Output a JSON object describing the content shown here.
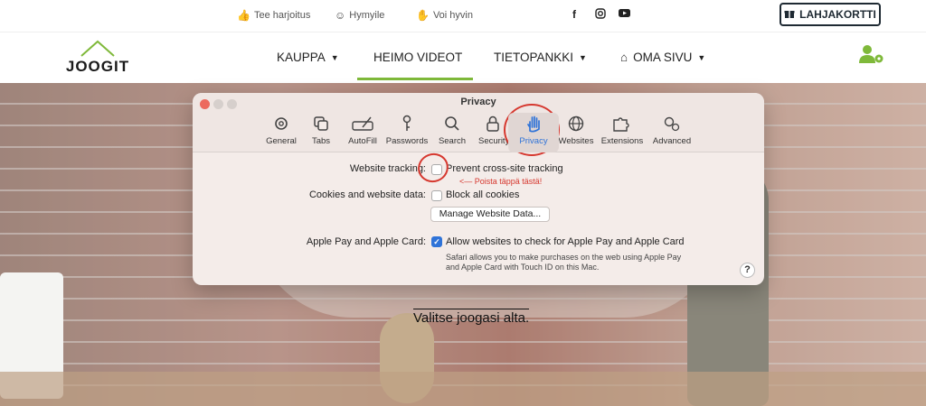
{
  "topbar": {
    "links": [
      {
        "icon": "thumbs-up-icon",
        "label": "Tee harjoitus"
      },
      {
        "icon": "smile-icon",
        "label": "Hymyile"
      },
      {
        "icon": "hand-icon",
        "label": "Voi hyvin"
      }
    ],
    "social": [
      "facebook-icon",
      "instagram-icon",
      "youtube-icon"
    ],
    "gift_button": "LAHJAKORTTI"
  },
  "nav": {
    "logo": "JOOGIT",
    "items": [
      "KAUPPA",
      "HEIMO VIDEOT",
      "TIETOPANKKI",
      "OMA SIVU"
    ],
    "active": "HEIMO VIDEOT"
  },
  "hero": {
    "subtitle": "Valitse joogasi alta."
  },
  "privacy_window": {
    "title": "Privacy",
    "toolbar": [
      "General",
      "Tabs",
      "AutoFill",
      "Passwords",
      "Search",
      "Security",
      "Privacy",
      "Websites",
      "Extensions",
      "Advanced"
    ],
    "active_tab": "Privacy",
    "website_tracking_label": "Website tracking:",
    "website_tracking_option": "Prevent cross-site tracking",
    "annotation": "<— Poista täppä tästä!",
    "cookies_label": "Cookies and website data:",
    "cookies_option": "Block all cookies",
    "manage_button": "Manage Website Data...",
    "applepay_label": "Apple Pay and Apple Card:",
    "applepay_option": "Allow websites to check for Apple Pay and Apple Card",
    "applepay_note_line1": "Safari allows you to make purchases on the web using Apple Pay",
    "applepay_note_line2": "and Apple Card with Touch ID on this Mac.",
    "help": "?"
  },
  "colors": {
    "accent_green": "#7fb93a",
    "safari_blue": "#2f73d8",
    "annotation_red": "#d6382f"
  }
}
